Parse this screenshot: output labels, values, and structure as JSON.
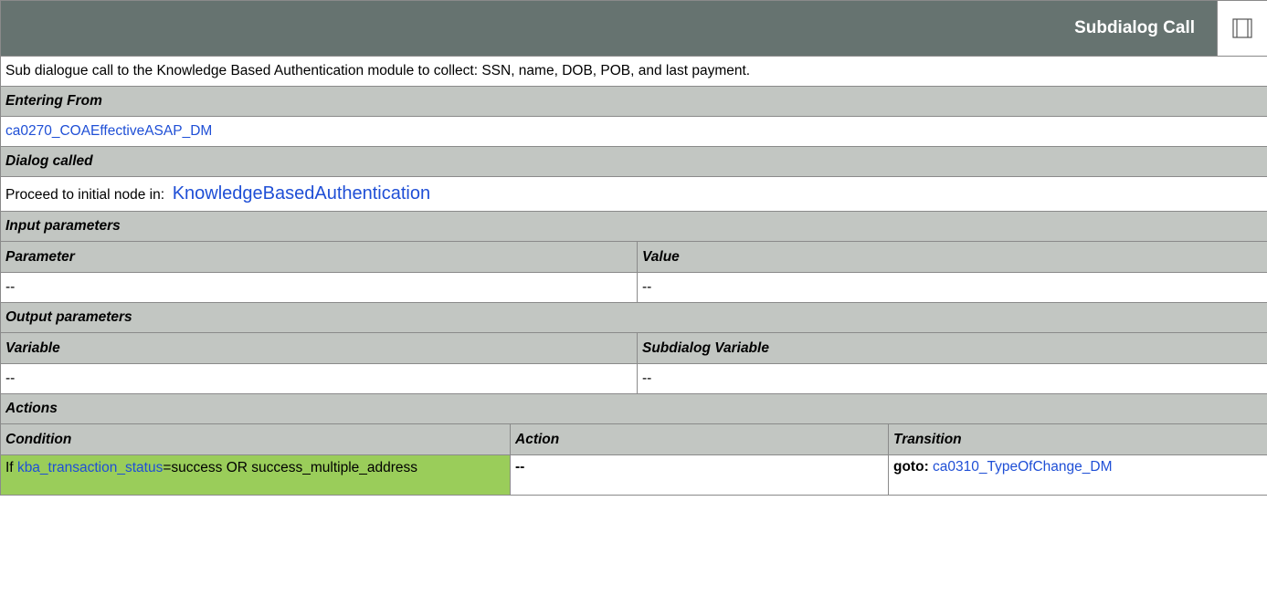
{
  "header": {
    "title": "Subdialog Call",
    "icon": "window-panel-icon"
  },
  "description": "Sub dialogue call to the Knowledge Based Authentication module to collect: SSN, name, DOB, POB, and last payment.",
  "entering_from": {
    "label": "Entering From",
    "link": "ca0270_COAEffectiveASAP_DM"
  },
  "dialog_called": {
    "label": "Dialog called",
    "prefix": "Proceed to initial node in:",
    "link": "KnowledgeBasedAuthentication"
  },
  "input_parameters": {
    "label": "Input parameters",
    "columns": [
      "Parameter",
      "Value"
    ],
    "rows": [
      [
        "--",
        "--"
      ]
    ]
  },
  "output_parameters": {
    "label": "Output parameters",
    "columns": [
      "Variable",
      "Subdialog Variable"
    ],
    "rows": [
      [
        "--",
        "--"
      ]
    ]
  },
  "actions": {
    "label": "Actions",
    "columns": [
      "Condition",
      "Action",
      "Transition"
    ],
    "rows": [
      {
        "condition_prefix": "If",
        "condition_link": "kba_transaction_status",
        "condition_suffix": "=success OR success_multiple_address",
        "action": "--",
        "transition_label": "goto:",
        "transition_link": "ca0310_TypeOfChange_DM"
      }
    ]
  },
  "colors": {
    "header_bg": "#667370",
    "section_bg": "#c2c6c2",
    "condition_bg": "#9acd5a",
    "link": "#1f4fd6"
  }
}
